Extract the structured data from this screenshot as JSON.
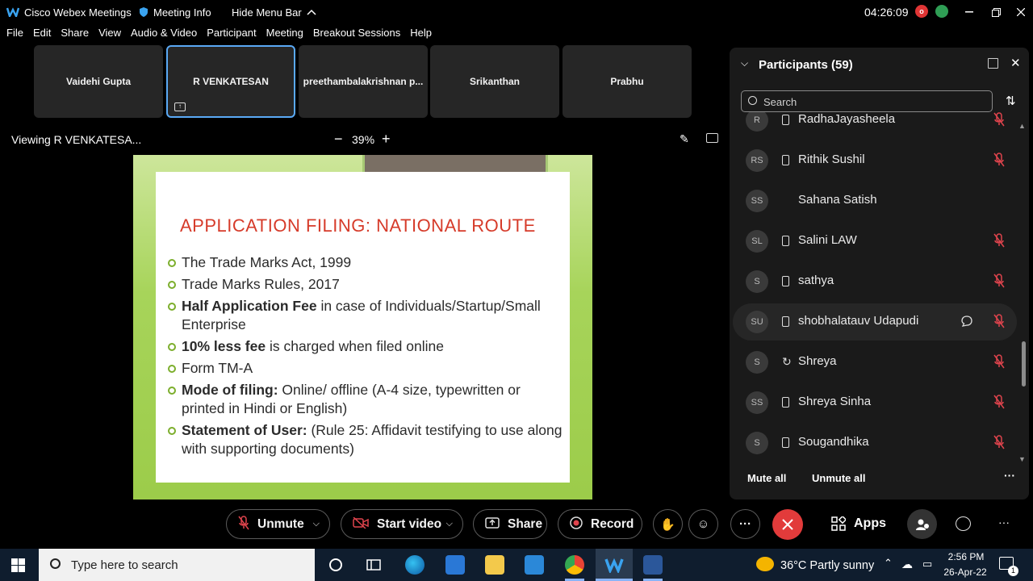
{
  "titlebar": {
    "app_name": "Cisco Webex Meetings",
    "meeting_info": "Meeting Info",
    "hide_menu": "Hide Menu Bar",
    "clock": "04:26:09",
    "avatar_initial": "o"
  },
  "menu": [
    "File",
    "Edit",
    "Share",
    "View",
    "Audio & Video",
    "Participant",
    "Meeting",
    "Breakout Sessions",
    "Help"
  ],
  "video_tiles": [
    "Vaidehi Gupta",
    "R VENKATESAN",
    "preethambalakrishnan p...",
    "Srikanthan",
    "Prabhu"
  ],
  "viewer": {
    "viewing_label": "Viewing R VENKATESA...",
    "zoom_minus": "−",
    "zoom": "39%",
    "zoom_plus": "+"
  },
  "slide": {
    "title": "APPLICATION FILING: NATIONAL ROUTE",
    "bullets": [
      {
        "bold": "",
        "text": "The Trade Marks Act, 1999"
      },
      {
        "bold": "",
        "text": "Trade Marks Rules, 2017"
      },
      {
        "bold": "Half Application Fee",
        "text": " in case of Individuals/Startup/Small Enterprise"
      },
      {
        "bold": "10% less fee",
        "text": " is charged when filed online"
      },
      {
        "bold": "",
        "text": "Form TM-A"
      },
      {
        "bold": "Mode of filing:",
        "text": " Online/ offline (A-4 size, typewritten or printed in Hindi or English)"
      },
      {
        "bold": "Statement of User:",
        "text": " (Rule 25: Affidavit testifying to use along with supporting documents)"
      }
    ]
  },
  "participants": {
    "title": "Participants (59)",
    "search_placeholder": "Search",
    "list": [
      {
        "initials": "R",
        "name": "RadhaJayasheela",
        "device": "phone",
        "muted": true
      },
      {
        "initials": "RS",
        "name": "Rithik Sushil",
        "device": "phone",
        "muted": true
      },
      {
        "initials": "SS",
        "name": "Sahana Satish",
        "device": "none",
        "muted": false
      },
      {
        "initials": "SL",
        "name": "Salini LAW",
        "device": "phone",
        "muted": true
      },
      {
        "initials": "S",
        "name": "sathya",
        "device": "phone",
        "muted": true
      },
      {
        "initials": "SU",
        "name": "shobhalatauv Udapudi",
        "device": "phone",
        "muted": true
      },
      {
        "initials": "S",
        "name": "Shreya",
        "device": "call",
        "muted": true
      },
      {
        "initials": "SS",
        "name": "Shreya Sinha",
        "device": "phone",
        "muted": true
      },
      {
        "initials": "S",
        "name": "Sougandhika",
        "device": "phone",
        "muted": true
      }
    ],
    "mute_all": "Mute all",
    "unmute_all": "Unmute all"
  },
  "controls": {
    "unmute": "Unmute",
    "start_video": "Start video",
    "share": "Share",
    "record": "Record",
    "apps": "Apps",
    "more": "···"
  },
  "taskbar": {
    "search_placeholder": "Type here to search",
    "weather": "36°C  Partly sunny",
    "time": "2:56 PM",
    "date": "26-Apr-22",
    "notifications": "1"
  },
  "colors": {
    "slide_title": "#d63b2a",
    "slide_bg": "#a7d45a",
    "accent_blue": "#5aa9f5",
    "leave_red": "#e23b3b",
    "mute_red": "#e0444d"
  }
}
